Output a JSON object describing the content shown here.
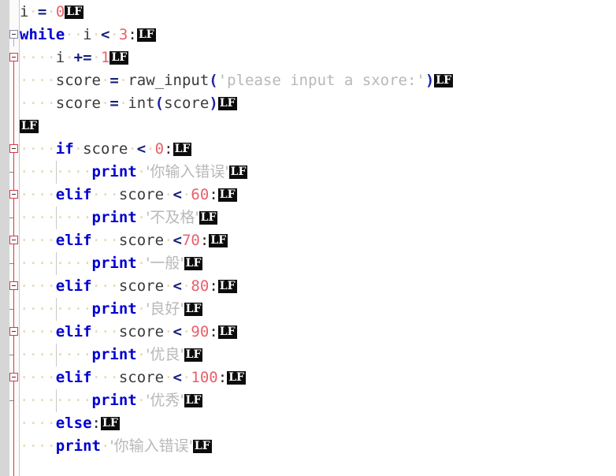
{
  "editor": {
    "app": "code-editor",
    "language": "Python",
    "background": "#ffffff",
    "gutter_color": "#d6d6d6",
    "fold_line_color": "#d23b4a",
    "colors": {
      "keyword": "#0000d0",
      "identifier": "#3a3a3a",
      "operator": "#14207a",
      "number": "#e8606a",
      "string": "#b8b8b8",
      "lf_badge_bg": "#0c0c0c",
      "lf_badge_fg": "#ffffff",
      "indent_dot": "#e8d9b0"
    },
    "eol_marker": "LF"
  },
  "lines": [
    {
      "n": 1,
      "indent": 0,
      "fold": "none",
      "tokens": [
        {
          "t": "ident",
          "v": "i"
        },
        {
          "t": "space",
          "v": 1
        },
        {
          "t": "op",
          "v": "="
        },
        {
          "t": "space",
          "v": 1
        },
        {
          "t": "num",
          "v": "0"
        },
        {
          "t": "lf",
          "v": "LF"
        }
      ],
      "text": "i = 0"
    },
    {
      "n": 2,
      "indent": 0,
      "fold": "open-grey",
      "tokens": [
        {
          "t": "kw",
          "v": "while"
        },
        {
          "t": "space",
          "v": 2
        },
        {
          "t": "ident",
          "v": "i"
        },
        {
          "t": "space",
          "v": 1
        },
        {
          "t": "op",
          "v": "<"
        },
        {
          "t": "space",
          "v": 1
        },
        {
          "t": "num",
          "v": "3"
        },
        {
          "t": "punc",
          "v": ":"
        },
        {
          "t": "lf",
          "v": "LF"
        }
      ],
      "text": "while  i < 3:"
    },
    {
      "n": 3,
      "indent": 4,
      "fold": "open-red",
      "tokens": [
        {
          "t": "ident",
          "v": "i"
        },
        {
          "t": "space",
          "v": 1
        },
        {
          "t": "op",
          "v": "+="
        },
        {
          "t": "space",
          "v": 1
        },
        {
          "t": "num",
          "v": "1"
        },
        {
          "t": "lf",
          "v": "LF"
        }
      ],
      "text": "    i += 1"
    },
    {
      "n": 4,
      "indent": 4,
      "fold": "none",
      "tokens": [
        {
          "t": "ident",
          "v": "score"
        },
        {
          "t": "space",
          "v": 1
        },
        {
          "t": "op",
          "v": "="
        },
        {
          "t": "space",
          "v": 1
        },
        {
          "t": "ident",
          "v": "raw_input"
        },
        {
          "t": "paren",
          "v": "("
        },
        {
          "t": "str",
          "v": "'please input a sxore:'"
        },
        {
          "t": "paren",
          "v": ")"
        },
        {
          "t": "lf",
          "v": "LF"
        }
      ],
      "text": "    score = raw_input('please input a sxore:')"
    },
    {
      "n": 5,
      "indent": 4,
      "fold": "none",
      "tokens": [
        {
          "t": "ident",
          "v": "score"
        },
        {
          "t": "space",
          "v": 1
        },
        {
          "t": "op",
          "v": "="
        },
        {
          "t": "space",
          "v": 1
        },
        {
          "t": "ident",
          "v": "int"
        },
        {
          "t": "paren",
          "v": "("
        },
        {
          "t": "ident",
          "v": "score"
        },
        {
          "t": "paren",
          "v": ")"
        },
        {
          "t": "lf",
          "v": "LF"
        }
      ],
      "text": "    score = int(score)"
    },
    {
      "n": 6,
      "indent": 0,
      "fold": "none",
      "tokens": [
        {
          "t": "lf",
          "v": "LF"
        }
      ],
      "text": ""
    },
    {
      "n": 7,
      "indent": 4,
      "fold": "open-red",
      "tokens": [
        {
          "t": "kw",
          "v": "if"
        },
        {
          "t": "space",
          "v": 1
        },
        {
          "t": "ident",
          "v": "score"
        },
        {
          "t": "space",
          "v": 1
        },
        {
          "t": "op",
          "v": "<"
        },
        {
          "t": "space",
          "v": 1
        },
        {
          "t": "num",
          "v": "0"
        },
        {
          "t": "punc",
          "v": ":"
        },
        {
          "t": "lf",
          "v": "LF"
        }
      ],
      "text": "    if score < 0:"
    },
    {
      "n": 8,
      "indent": 8,
      "fold": "tick",
      "tokens": [
        {
          "t": "kw",
          "v": "print"
        },
        {
          "t": "space",
          "v": 1
        },
        {
          "t": "cjk",
          "v": "'你输入错误'"
        },
        {
          "t": "lf",
          "v": "LF"
        }
      ],
      "text": "        print '你输入错误'"
    },
    {
      "n": 9,
      "indent": 4,
      "fold": "open-red",
      "tokens": [
        {
          "t": "kw",
          "v": "elif"
        },
        {
          "t": "space",
          "v": 3
        },
        {
          "t": "ident",
          "v": "score"
        },
        {
          "t": "space",
          "v": 1
        },
        {
          "t": "op",
          "v": "<"
        },
        {
          "t": "space",
          "v": 1
        },
        {
          "t": "num",
          "v": "60"
        },
        {
          "t": "punc",
          "v": ":"
        },
        {
          "t": "lf",
          "v": "LF"
        }
      ],
      "text": "    elif   score < 60:"
    },
    {
      "n": 10,
      "indent": 8,
      "fold": "tick",
      "tokens": [
        {
          "t": "kw",
          "v": "print"
        },
        {
          "t": "space",
          "v": 1
        },
        {
          "t": "cjk",
          "v": "'不及格'"
        },
        {
          "t": "lf",
          "v": "LF"
        }
      ],
      "text": "        print '不及格'"
    },
    {
      "n": 11,
      "indent": 4,
      "fold": "open-red",
      "tokens": [
        {
          "t": "kw",
          "v": "elif"
        },
        {
          "t": "space",
          "v": 3
        },
        {
          "t": "ident",
          "v": "score"
        },
        {
          "t": "space",
          "v": 1
        },
        {
          "t": "op",
          "v": "<"
        },
        {
          "t": "num",
          "v": "70"
        },
        {
          "t": "punc",
          "v": ":"
        },
        {
          "t": "lf",
          "v": "LF"
        }
      ],
      "text": "    elif   score <70:"
    },
    {
      "n": 12,
      "indent": 8,
      "fold": "tick",
      "tokens": [
        {
          "t": "kw",
          "v": "print"
        },
        {
          "t": "space",
          "v": 1
        },
        {
          "t": "cjk",
          "v": "'一般'"
        },
        {
          "t": "lf",
          "v": "LF"
        }
      ],
      "text": "        print '一般'"
    },
    {
      "n": 13,
      "indent": 4,
      "fold": "open-red",
      "tokens": [
        {
          "t": "kw",
          "v": "elif"
        },
        {
          "t": "space",
          "v": 3
        },
        {
          "t": "ident",
          "v": "score"
        },
        {
          "t": "space",
          "v": 1
        },
        {
          "t": "op",
          "v": "<"
        },
        {
          "t": "space",
          "v": 1
        },
        {
          "t": "num",
          "v": "80"
        },
        {
          "t": "punc",
          "v": ":"
        },
        {
          "t": "lf",
          "v": "LF"
        }
      ],
      "text": "    elif   score < 80:"
    },
    {
      "n": 14,
      "indent": 8,
      "fold": "tick",
      "tokens": [
        {
          "t": "kw",
          "v": "print"
        },
        {
          "t": "space",
          "v": 1
        },
        {
          "t": "cjk",
          "v": "'良好'"
        },
        {
          "t": "lf",
          "v": "LF"
        }
      ],
      "text": "        print '良好'"
    },
    {
      "n": 15,
      "indent": 4,
      "fold": "open-red",
      "tokens": [
        {
          "t": "kw",
          "v": "elif"
        },
        {
          "t": "space",
          "v": 3
        },
        {
          "t": "ident",
          "v": "score"
        },
        {
          "t": "space",
          "v": 1
        },
        {
          "t": "op",
          "v": "<"
        },
        {
          "t": "space",
          "v": 1
        },
        {
          "t": "num",
          "v": "90"
        },
        {
          "t": "punc",
          "v": ":"
        },
        {
          "t": "lf",
          "v": "LF"
        }
      ],
      "text": "    elif   score < 90:"
    },
    {
      "n": 16,
      "indent": 8,
      "fold": "tick",
      "tokens": [
        {
          "t": "kw",
          "v": "print"
        },
        {
          "t": "space",
          "v": 1
        },
        {
          "t": "cjk",
          "v": "'优良'"
        },
        {
          "t": "lf",
          "v": "LF"
        }
      ],
      "text": "        print '优良'"
    },
    {
      "n": 17,
      "indent": 4,
      "fold": "open-red",
      "tokens": [
        {
          "t": "kw",
          "v": "elif"
        },
        {
          "t": "space",
          "v": 3
        },
        {
          "t": "ident",
          "v": "score"
        },
        {
          "t": "space",
          "v": 1
        },
        {
          "t": "op",
          "v": "<"
        },
        {
          "t": "space",
          "v": 1
        },
        {
          "t": "num",
          "v": "100"
        },
        {
          "t": "punc",
          "v": ":"
        },
        {
          "t": "lf",
          "v": "LF"
        }
      ],
      "text": "    elif   score < 100:"
    },
    {
      "n": 18,
      "indent": 8,
      "fold": "tick",
      "tokens": [
        {
          "t": "kw",
          "v": "print"
        },
        {
          "t": "space",
          "v": 1
        },
        {
          "t": "cjk",
          "v": "'优秀'"
        },
        {
          "t": "lf",
          "v": "LF"
        }
      ],
      "text": "        print '优秀'"
    },
    {
      "n": 19,
      "indent": 4,
      "fold": "none",
      "tokens": [
        {
          "t": "kw",
          "v": "else"
        },
        {
          "t": "punc",
          "v": ":"
        },
        {
          "t": "lf",
          "v": "LF"
        }
      ],
      "text": "    else:"
    },
    {
      "n": 20,
      "indent": 4,
      "fold": "none",
      "tokens": [
        {
          "t": "kw",
          "v": "print"
        },
        {
          "t": "space",
          "v": 1
        },
        {
          "t": "cjk",
          "v": "'你输入错误'"
        },
        {
          "t": "lf",
          "v": "LF"
        }
      ],
      "text": "    print '你输入错误'"
    }
  ]
}
